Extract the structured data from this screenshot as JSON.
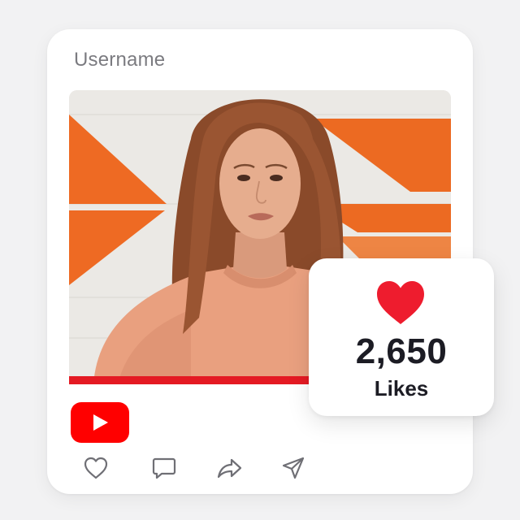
{
  "post": {
    "username": "Username",
    "progress_fraction": 0.63
  },
  "likes": {
    "count": "2,650",
    "label": "Likes"
  },
  "icons": {
    "logo": "youtube-play-icon",
    "like": "heart-outline-icon",
    "comment": "comment-icon",
    "share": "share-icon",
    "send": "send-icon",
    "likes_badge": "heart-filled-icon"
  },
  "colors": {
    "accent_red": "#e41a23",
    "youtube_red": "#ff0000",
    "heart_red": "#ee1c2e",
    "wall_orange": "#ee6a23",
    "text_dark": "#1c1c24",
    "text_gray": "#7b7b80"
  }
}
